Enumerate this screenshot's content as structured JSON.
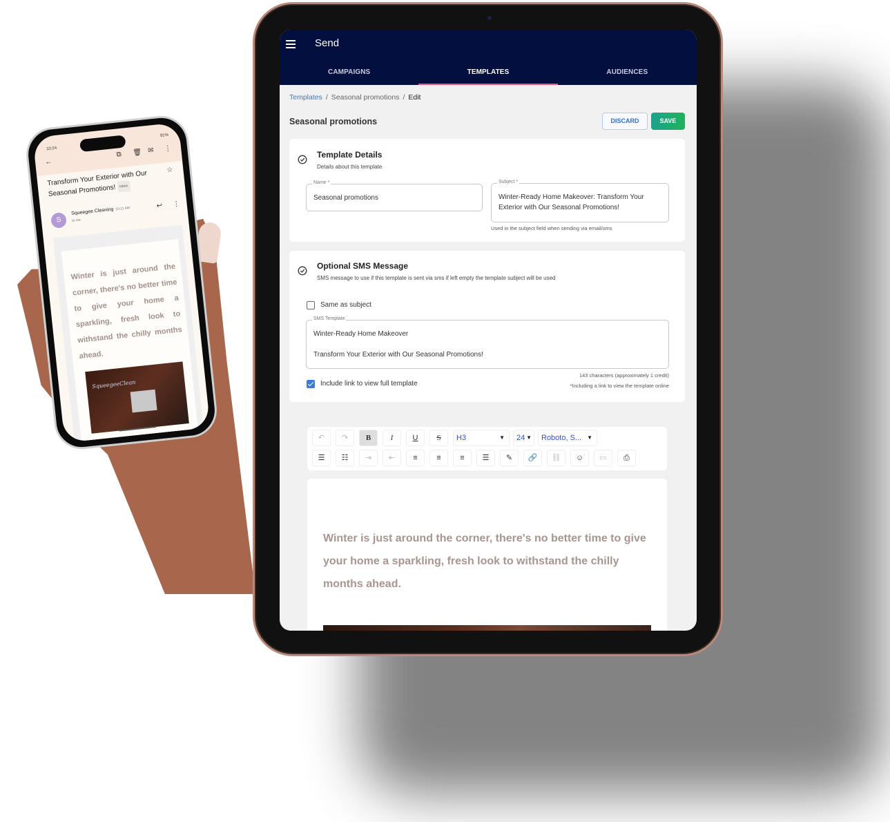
{
  "tablet": {
    "app_title": "Send",
    "tabs": [
      {
        "label": "CAMPAIGNS",
        "active": false
      },
      {
        "label": "TEMPLATES",
        "active": true
      },
      {
        "label": "AUDIENCES",
        "active": false
      }
    ],
    "breadcrumb": {
      "root": "Templates",
      "item": "Seasonal promotions",
      "current": "Edit",
      "separator": "/"
    },
    "page_title": "Seasonal promotions",
    "actions": {
      "discard": "DISCARD",
      "save": "SAVE"
    },
    "template_details": {
      "title": "Template Details",
      "subtitle": "Details about this template",
      "name_label": "Name *",
      "name_value": "Seasonal promotions",
      "subject_label": "Subject *",
      "subject_value": "Winter-Ready Home Makeover: Transform Your Exterior with Our Seasonal Promotions!",
      "subject_hint": "Used in the subject field when sending via email/sms"
    },
    "sms": {
      "title": "Optional SMS Message",
      "subtitle": "SMS message to use if this template is sent via sms if left empty the template subject will be used",
      "same_as_subject_label": "Same as subject",
      "same_as_subject_checked": false,
      "template_label": "SMS Template",
      "template_line1": "Winter-Ready Home Makeover",
      "template_line2": "Transform Your Exterior with Our Seasonal Promotions!",
      "char_count": "143 characters (approximately 1 credit)",
      "link_note": "*Including a link to view the template online",
      "include_link_label": "Include link to view full template",
      "include_link_checked": true
    },
    "editor": {
      "toolbar": {
        "undo": "↶",
        "redo": "↷",
        "bold": "B",
        "italic": "I",
        "underline": "U",
        "strike": "S",
        "block_format": "H3",
        "font_size": "24",
        "font_family": "Roboto, S...",
        "caret": "▼"
      },
      "body_text": "Winter is just around the corner, there's no better time to give your home a sparkling, fresh look to withstand the chilly months ahead."
    },
    "colors": {
      "appbar": "#020f3f",
      "tab_indicator": "#f0557a",
      "link": "#3b77d0",
      "save_button": "#1fb25c",
      "editor_text": "#a8958e"
    }
  },
  "phone": {
    "time": "10:24",
    "status": "91%",
    "subject": "Transform Your Exterior with Our Seasonal Promotions!",
    "inbox_badge": "Inbox",
    "avatar_letter": "S",
    "sender": "Squeegee Cleaning",
    "sent_time": "10:11 AM",
    "to": "to me",
    "body_text": "Winter is just around the corner, there's no better time to give your home a sparkling, fresh look to withstand the chilly months ahead.",
    "image_logo": "SqueegeeClean"
  }
}
